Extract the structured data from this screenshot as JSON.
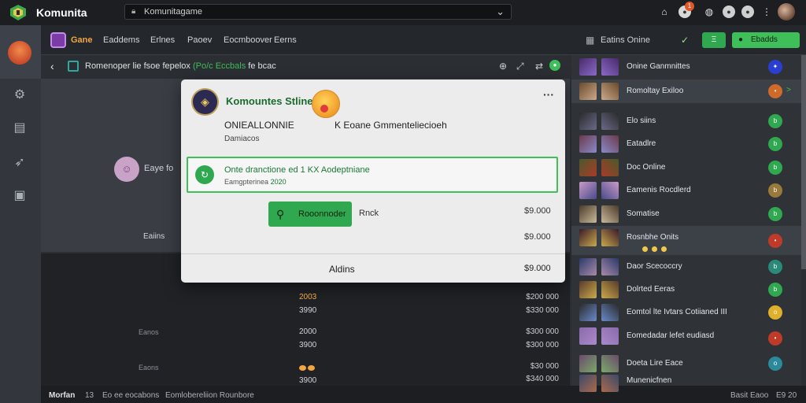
{
  "titlebar": {
    "app_title": "Komunita",
    "search_value": "Komunitagame",
    "notif_count": "1"
  },
  "nav": {
    "items": [
      "Gane",
      "Eaddems",
      "Erlnes",
      "Paoev",
      "Eocmboover",
      "Eerns"
    ],
    "online_label": "Eatins Onine",
    "primary_button": "Ebadds",
    "small_button": "Ξ"
  },
  "breadcrumb": {
    "prefix": "Romenoper lie fsoe fepelox",
    "highlight": "(Po/c Eccbals",
    "suffix": "fe bcac"
  },
  "side": {
    "name": "Eaye fo",
    "label": "Eaiins"
  },
  "card": {
    "title": "Komountes Stline",
    "line1": "ONIEALLONNIE",
    "line2": "K Eoane Gmmenteliecioeh",
    "line3": "Damiacos",
    "notice_title": "Onte dranctione ed 1 KX Aodeptniane",
    "notice_sub_prefix": "Eamgpterinea",
    "notice_sub_num": "2020",
    "button_label": "Rooonnoder",
    "back_label": "Rnck",
    "amount1": "$9.000",
    "amount2": "$9.000",
    "footer_label": "Aldins",
    "footer_amount": "$9.000"
  },
  "rows": [
    {
      "label": "",
      "val": "2003",
      "val_orange": true,
      "amt": "$200 000"
    },
    {
      "label": "",
      "val": "3990",
      "val_orange": false,
      "amt": "$330 000"
    },
    {
      "label": "Eanos",
      "val": "2000",
      "val_orange": false,
      "amt": "$300 000"
    },
    {
      "label": "",
      "val": "3900",
      "val_orange": false,
      "amt": "$300 000"
    },
    {
      "label": "Eaons",
      "val": "",
      "val_orange": false,
      "amt": "$30 000"
    },
    {
      "label": "",
      "val": "3900",
      "val_orange": false,
      "amt": "$340 000"
    }
  ],
  "status": {
    "items": [
      "Morfan",
      "13",
      "Eo ee eocabons",
      "Eomlobereliion Rounbore"
    ],
    "right1": "Basit Eaoo",
    "right2": "E9 20"
  },
  "sidebar": [
    {
      "name": "Onine Ganmnittes",
      "badge": "✦",
      "badge_color": "#2a3fd0",
      "arrow": ""
    },
    {
      "name": "Romoltay Exiloo",
      "badge": "•",
      "badge_color": "#d06a2a",
      "arrow": ">",
      "active": true
    },
    {
      "name": "Elo siins",
      "badge": "b",
      "badge_color": "#2fa84f",
      "arrow": ""
    },
    {
      "name": "Eatadlre",
      "badge": "b",
      "badge_color": "#2fa84f",
      "arrow": ""
    },
    {
      "name": "Doc Online",
      "badge": "b",
      "badge_color": "#2fa84f",
      "arrow": ""
    },
    {
      "name": "Eamenis Rocdlerd",
      "badge": "b",
      "badge_color": "#9a7a3a",
      "arrow": ""
    },
    {
      "name": "Somatise",
      "badge": "b",
      "badge_color": "#2fa84f",
      "arrow": ""
    },
    {
      "name": "Rosnbhe Onits",
      "badge": "•",
      "badge_color": "#c03a2a",
      "arrow": "",
      "active": true
    },
    {
      "name": "Daor Scecoccry",
      "badge": "b",
      "badge_color": "#2a8a7a",
      "arrow": ""
    },
    {
      "name": "Dolrted Eeras",
      "badge": "b",
      "badge_color": "#2fa84f",
      "arrow": ""
    },
    {
      "name": "Eomtol lte Ivtars Cotiianed III",
      "badge": "o",
      "badge_color": "#e0b02a",
      "arrow": ""
    },
    {
      "name": "Eomedadar lefet eudiasd",
      "badge": "•",
      "badge_color": "#c03a2a",
      "arrow": ""
    },
    {
      "name": "Doeta Lire Eace",
      "badge": "o",
      "badge_color": "#2a8a9a",
      "arrow": ""
    },
    {
      "name": "Munenicfnen",
      "badge": "",
      "badge_color": "#2fa84f",
      "arrow": ""
    }
  ],
  "colors": {
    "accent_green": "#3fbf5a",
    "accent_orange": "#f2a640",
    "background": "#2b2e33"
  }
}
